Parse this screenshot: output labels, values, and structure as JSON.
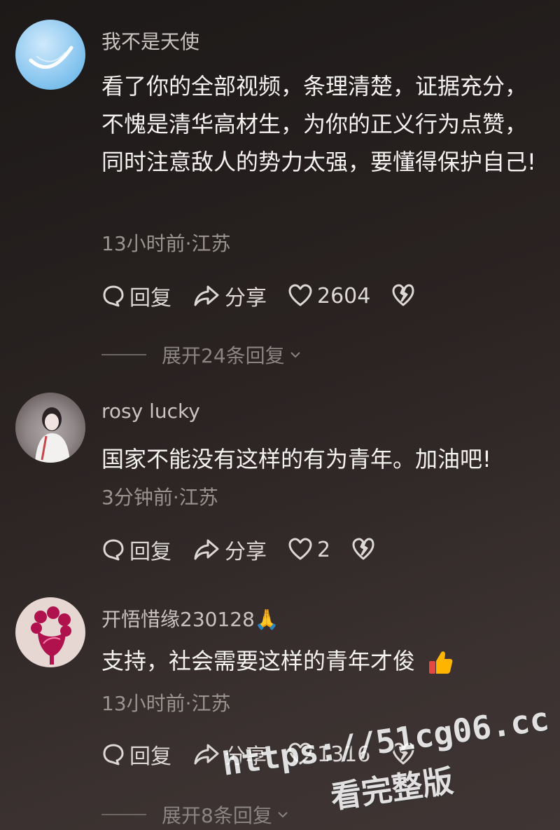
{
  "comments": [
    {
      "username": "我不是天使",
      "text": "看了你的全部视频，条理清楚，证据充分，不愧是清华高材生，为你的正义行为点赞，同时注意敌人的势力太强，要懂得保护自己!",
      "meta": "13小时前·江苏",
      "reply_label": "回复",
      "share_label": "分享",
      "likes": "2604",
      "expand": "展开24条回复"
    },
    {
      "username": "rosy lucky",
      "text": "国家不能没有这样的有为青年。加油吧!",
      "meta": "3分钟前·江苏",
      "reply_label": "回复",
      "share_label": "分享",
      "likes": "2"
    },
    {
      "username": "开悟惜缘230128🙏",
      "text": "支持，社会需要这样的青年才俊",
      "meta": "13小时前·江苏",
      "reply_label": "回复",
      "share_label": "分享",
      "likes": "1316",
      "expand": "展开8条回复"
    }
  ],
  "watermark": {
    "url": "https://51cg06.cc",
    "sub": "看完整版"
  },
  "colors": {
    "background": "#2a2322",
    "text": "#f4f2f1",
    "muted": "#9a9491"
  }
}
